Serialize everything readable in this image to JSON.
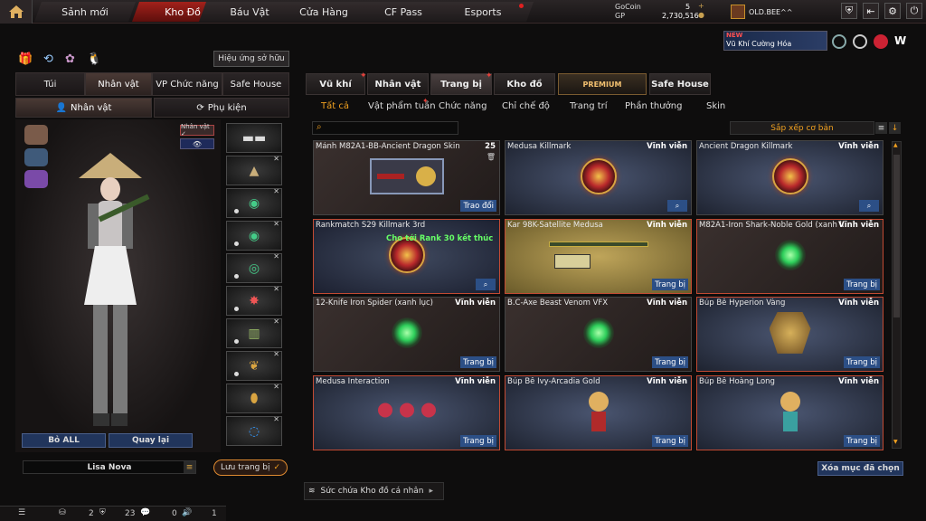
{
  "topnav": {
    "tabs": [
      "Sảnh mới",
      "Kho Đồ",
      "Báu Vật",
      "Cửa Hàng",
      "CF Pass",
      "Esports"
    ],
    "active": 1
  },
  "currency": {
    "gocoin_label": "GoCoin",
    "gocoin_value": "5",
    "gp_label": "GP",
    "gp_value": "2,730,516"
  },
  "user": {
    "name": "OLD.BEE^^"
  },
  "banner": {
    "badge": "NEW",
    "text": "Vũ Khí Cường Hóa"
  },
  "left": {
    "effect_btn": "Hiệu ứng sở hữu",
    "tabs": [
      "Túi",
      "Nhân vật",
      "VP Chức năng",
      "Safe House"
    ],
    "subtabs": [
      "Nhân vật",
      "Phụ kiện"
    ],
    "char_badge": "Nhân vật ✓",
    "remove_all": "Bỏ ALL",
    "back": "Quay lại",
    "char_name": "Lisa Nova",
    "save_btn": "Lưu trang bị"
  },
  "right": {
    "tabs": [
      "Vũ khí",
      "Nhân vật",
      "Trang bị",
      "Kho đồ",
      "PREMIUM",
      "Safe House"
    ],
    "subtabs": [
      "Tất cả",
      "Vật phẩm tuần",
      "Chức năng",
      "Chỉ chế độ",
      "Trang trí",
      "Phần thưởng",
      "Skin"
    ],
    "sort_label": "Sắp xếp cơ bản",
    "clear_btn": "Xóa mục đã chọn",
    "items": [
      {
        "name": "Mảnh M82A1-BB-Ancient Dragon Skin",
        "status": "25",
        "action": "Trao đổi",
        "art": "gun"
      },
      {
        "name": "Medusa Killmark",
        "status": "Vĩnh viễn",
        "action": "",
        "art": "emblem"
      },
      {
        "name": "Ancient Dragon Killmark",
        "status": "Vĩnh viễn",
        "action": "",
        "art": "emblem"
      },
      {
        "name": "Rankmatch S29 Killmark 3rd",
        "status": "",
        "action": "",
        "note": "Cho tới Rank 30 kết thúc",
        "art": "emblem"
      },
      {
        "name": "Kar 98K-Satellite Medusa",
        "status": "Vĩnh viễn",
        "action": "Trang bị",
        "art": "rifle"
      },
      {
        "name": "M82A1-Iron Shark-Noble Gold (xanh lục)",
        "status": "Vĩnh viễn",
        "action": "Trang bị",
        "art": "glow"
      },
      {
        "name": "12-Knife Iron Spider (xanh lục)",
        "status": "Vĩnh viễn",
        "action": "Trang bị",
        "art": "glow"
      },
      {
        "name": "B.C-Axe Beast Venom VFX",
        "status": "Vĩnh viễn",
        "action": "Trang bị",
        "art": "glow"
      },
      {
        "name": "Búp Bê Hyperion Vàng",
        "status": "Vĩnh viễn",
        "action": "Trang bị",
        "art": "mech"
      },
      {
        "name": "Medusa Interaction",
        "status": "Vĩnh viễn",
        "action": "Trang bị",
        "art": "dolls"
      },
      {
        "name": "Búp Bê Ivy-Arcadia Gold",
        "status": "Vĩnh viễn",
        "action": "Trang bị",
        "art": "doll"
      },
      {
        "name": "Búp Bê Hoàng Long",
        "status": "Vĩnh viễn",
        "action": "Trang bị",
        "art": "doll"
      }
    ]
  },
  "footer": {
    "repair_text": "Sức chứa Kho đồ cá nhân",
    "counts": [
      "2",
      "23",
      "0",
      "1"
    ]
  }
}
